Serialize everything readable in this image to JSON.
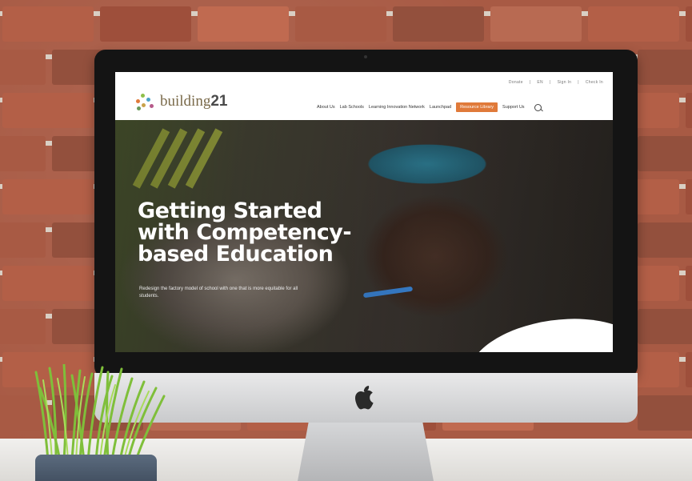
{
  "website": {
    "utility_links": [
      "Donate",
      "|",
      "EN",
      "|",
      "Sign In",
      "|",
      "Check In"
    ],
    "logo": {
      "text_plain": "building",
      "text_bold": "21"
    },
    "menu": [
      {
        "label": "About Us",
        "highlighted": false
      },
      {
        "label": "Lab Schools",
        "highlighted": false
      },
      {
        "label": "Learning Innovation Network",
        "highlighted": false
      },
      {
        "label": "Launchpad",
        "highlighted": false
      },
      {
        "label": "Resource Library",
        "highlighted": true
      },
      {
        "label": "Support Us",
        "highlighted": false
      }
    ],
    "hero": {
      "headline_lines": [
        "Getting Started",
        "with Competency-",
        "based Education"
      ],
      "subtext": "Redesign the factory model of school with one that is more equitable for all students."
    }
  },
  "colors": {
    "accent": "#e07a3a",
    "brick": "#a85a44",
    "mortar": "#d9cfc4",
    "imac_bezel": "#141414"
  },
  "icons": [
    "search-icon",
    "apple-logo-icon"
  ]
}
